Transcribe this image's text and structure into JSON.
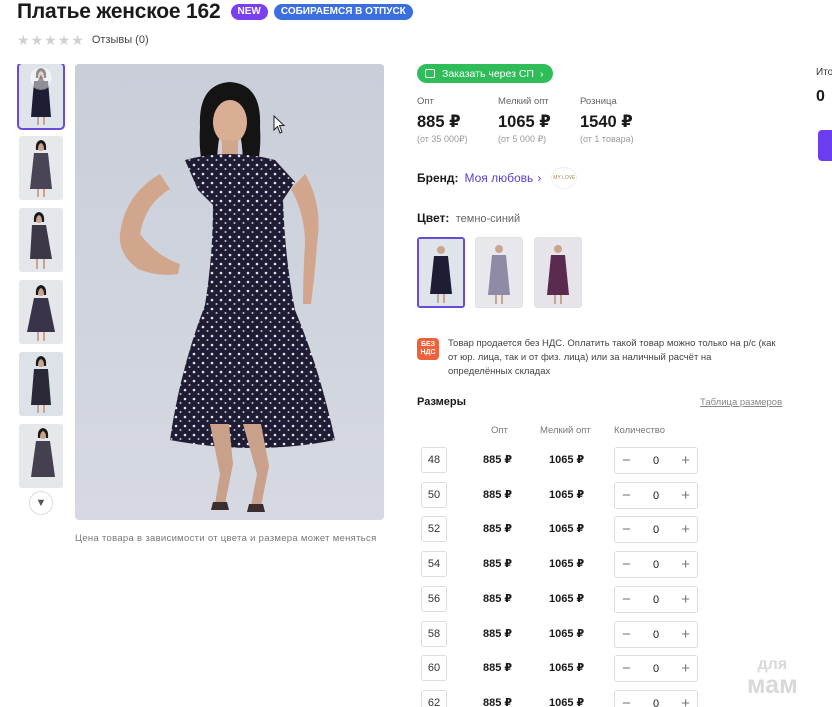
{
  "product": {
    "title": "Платье женское 162",
    "badges": [
      "NEW",
      "СОБИРАЕМСЯ В ОТПУСК"
    ],
    "reviews": "Отзывы (0)"
  },
  "gallery": {
    "note": "Цена товара в зависимости от цвета и размера может меняться"
  },
  "order_sp": "Заказать через СП",
  "prices": [
    {
      "label": "Опт",
      "value": "885 ₽",
      "sub": "(от 35 000₽)"
    },
    {
      "label": "Мелкий опт",
      "value": "1065 ₽",
      "sub": "(от 5 000 ₽)"
    },
    {
      "label": "Розница",
      "value": "1540 ₽",
      "sub": "(от 1 товара)"
    }
  ],
  "brand": {
    "label": "Бренд:",
    "name": "Моя любовь",
    "logo_text": "MY LOVE"
  },
  "color": {
    "label": "Цвет:",
    "value": "темно-синий"
  },
  "vat": {
    "icon_text": "БЕЗ НДС",
    "text": "Товар продается без НДС. Оплатить такой товар можно только на р/с (как от юр. лица, так и от физ. лица) или за наличный расчёт на определённых складах"
  },
  "sizes": {
    "title": "Размеры",
    "table_link": "Таблица размеров",
    "columns": [
      "Опт",
      "Мелкий опт",
      "Количество"
    ],
    "rows": [
      {
        "size": "48",
        "opt": "885 ₽",
        "small_opt": "1065 ₽",
        "qty": "0"
      },
      {
        "size": "50",
        "opt": "885 ₽",
        "small_opt": "1065 ₽",
        "qty": "0"
      },
      {
        "size": "52",
        "opt": "885 ₽",
        "small_opt": "1065 ₽",
        "qty": "0"
      },
      {
        "size": "54",
        "opt": "885 ₽",
        "small_opt": "1065 ₽",
        "qty": "0"
      },
      {
        "size": "56",
        "opt": "885 ₽",
        "small_opt": "1065 ₽",
        "qty": "0"
      },
      {
        "size": "58",
        "opt": "885 ₽",
        "small_opt": "1065 ₽",
        "qty": "0"
      },
      {
        "size": "60",
        "opt": "885 ₽",
        "small_opt": "1065 ₽",
        "qty": "0"
      },
      {
        "size": "62",
        "opt": "885 ₽",
        "small_opt": "1065 ₽",
        "qty": "0"
      }
    ],
    "minus": "−",
    "plus": "+"
  },
  "summary": {
    "label": "Ито",
    "value": "0"
  },
  "watermark": {
    "line1": "для",
    "line2": "мам"
  },
  "colors": {
    "accent": "#6a4bd8",
    "badge_new": "#7b3ff2",
    "badge_vacation": "#3b6fe0",
    "sp_button": "#2fbd5a",
    "vat_icon": "#f0603a",
    "dress_navy": "#1f1d33"
  }
}
